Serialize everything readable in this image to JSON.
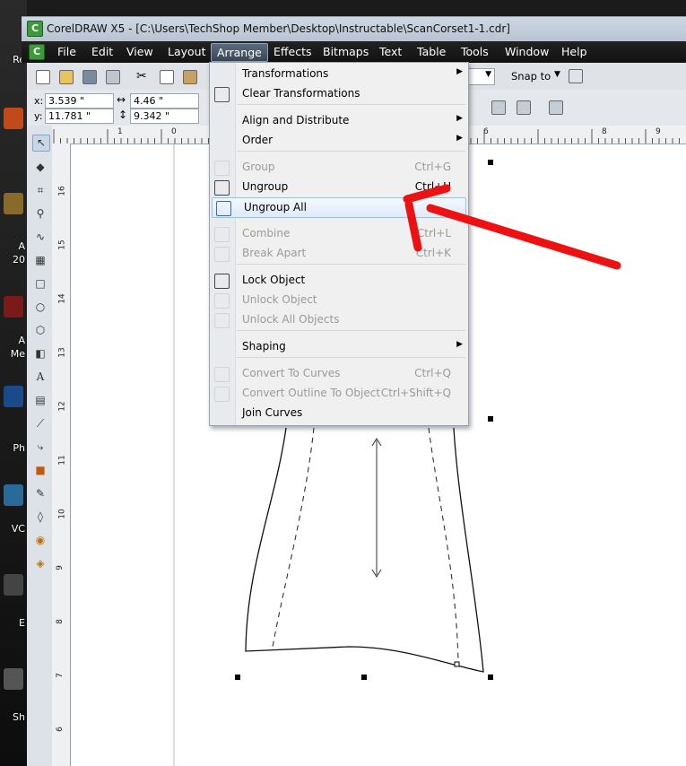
{
  "desktop": {
    "labels": [
      "Re",
      "A",
      "20",
      "A",
      "Me",
      "Ph",
      "VC",
      "E",
      "Sh"
    ]
  },
  "window": {
    "title": "CorelDRAW X5 - [C:\\Users\\TechShop Member\\Desktop\\Instructable\\ScanCorset1-1.cdr]"
  },
  "menubar": {
    "items": [
      "File",
      "Edit",
      "View",
      "Layout",
      "Arrange",
      "Effects",
      "Bitmaps",
      "Text",
      "Table",
      "Tools",
      "Window",
      "Help"
    ],
    "active": "Arrange"
  },
  "toolbar": {
    "snap_to": "Snap to"
  },
  "properties": {
    "x_label": "x:",
    "x_value": "3.539 \"",
    "y_label": "y:",
    "y_value": "11.781 \"",
    "w_value": "4.46 \"",
    "h_value": "9.342 \""
  },
  "ruler": {
    "top": [
      "1",
      "0",
      "1",
      "6",
      "8",
      "9"
    ],
    "left": [
      "16",
      "15",
      "14",
      "13",
      "12",
      "11",
      "10",
      "9",
      "8",
      "7",
      "6"
    ]
  },
  "arrange_menu": {
    "items": [
      {
        "label": "Transformations",
        "shortcut": "",
        "submenu": true,
        "disabled": false
      },
      {
        "label": "Clear Transformations",
        "shortcut": "",
        "submenu": false,
        "disabled": false
      },
      {
        "label": "Align and Distribute",
        "shortcut": "",
        "submenu": true,
        "disabled": false
      },
      {
        "label": "Order",
        "shortcut": "",
        "submenu": true,
        "disabled": false
      },
      {
        "label": "Group",
        "shortcut": "Ctrl+G",
        "submenu": false,
        "disabled": true
      },
      {
        "label": "Ungroup",
        "shortcut": "Ctrl+U",
        "submenu": false,
        "disabled": false
      },
      {
        "label": "Ungroup All",
        "shortcut": "",
        "submenu": false,
        "disabled": false,
        "highlighted": true
      },
      {
        "label": "Combine",
        "shortcut": "Ctrl+L",
        "submenu": false,
        "disabled": true
      },
      {
        "label": "Break Apart",
        "shortcut": "Ctrl+K",
        "submenu": false,
        "disabled": true
      },
      {
        "label": "Lock Object",
        "shortcut": "",
        "submenu": false,
        "disabled": false
      },
      {
        "label": "Unlock Object",
        "shortcut": "",
        "submenu": false,
        "disabled": true
      },
      {
        "label": "Unlock All Objects",
        "shortcut": "",
        "submenu": false,
        "disabled": true
      },
      {
        "label": "Shaping",
        "shortcut": "",
        "submenu": true,
        "disabled": false
      },
      {
        "label": "Convert To Curves",
        "shortcut": "Ctrl+Q",
        "submenu": false,
        "disabled": true
      },
      {
        "label": "Convert Outline To Object",
        "shortcut": "Ctrl+Shift+Q",
        "submenu": false,
        "disabled": true
      },
      {
        "label": "Join Curves",
        "shortcut": "",
        "submenu": false,
        "disabled": false
      }
    ]
  },
  "colors": {
    "annotation_arrow": "#ee1111",
    "menu_highlight": "#dceafa",
    "menubar_bg": "#111111"
  }
}
